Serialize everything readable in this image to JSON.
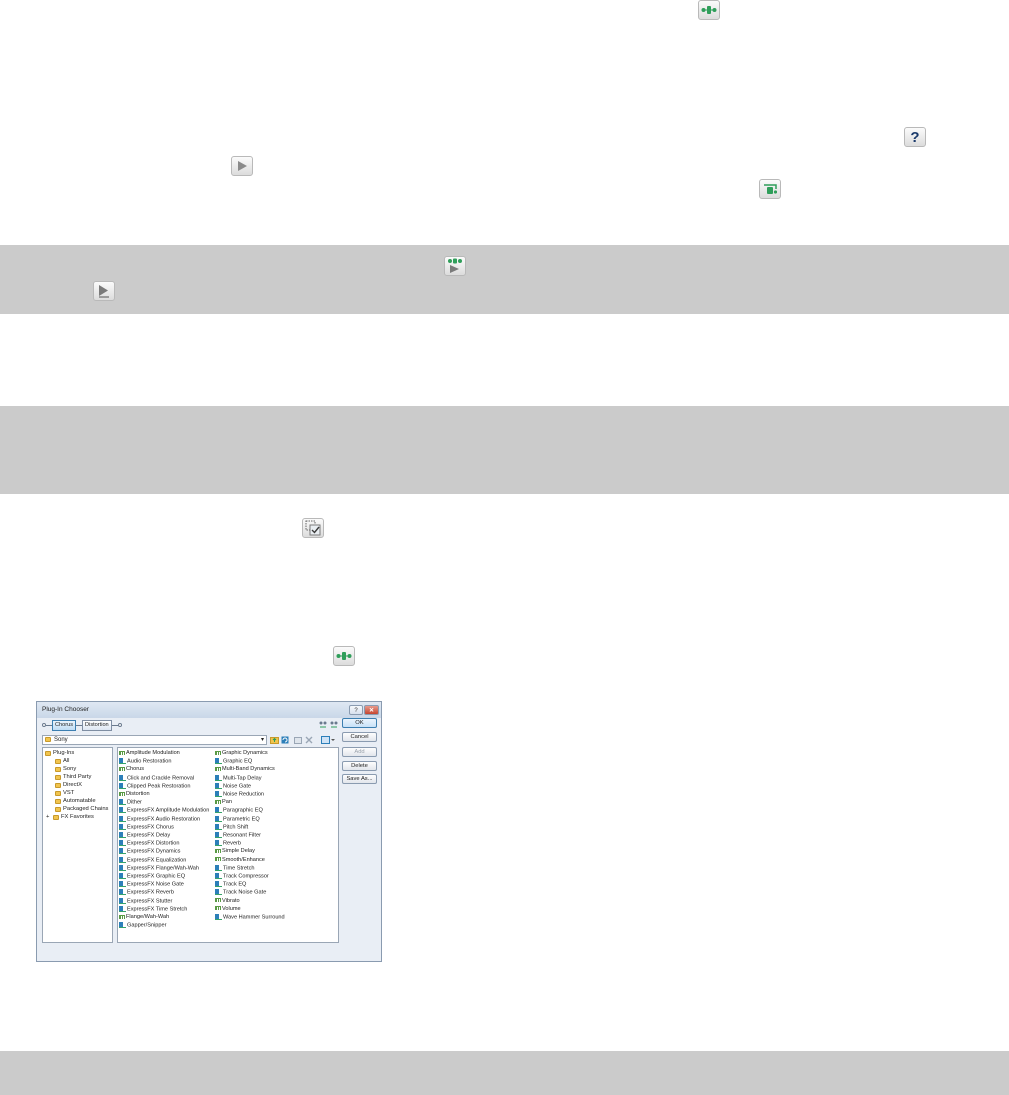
{
  "icons": {
    "plugin_chain": "plugin-chain-icon",
    "help": "help-icon",
    "play": "play-icon",
    "bypass": "bypass-icon",
    "chain_play": "chain-play-icon",
    "play_all": "play-all-icon",
    "select_all": "select-all-icon"
  },
  "colors": {
    "band": "#cbcbcb",
    "accent_green": "#2f9e5a",
    "help_blue": "#1a3a6b"
  },
  "dialog": {
    "title": "Plug-In Chooser",
    "help_glyph": "?",
    "close_glyph": "✕",
    "chain": [
      "Chorus",
      "Distortion"
    ],
    "buttons": {
      "ok": "OK",
      "cancel": "Cancel",
      "add": "Add",
      "delete": "Delete",
      "save_as": "Save As..."
    },
    "combo_value": "Sony",
    "tree": {
      "root": "Plug-Ins",
      "children": [
        "All",
        "Sony",
        "Third Party",
        "DirectX",
        "VST",
        "Automatable",
        "Packaged Chains"
      ],
      "favorites": "FX Favorites",
      "expander": "+"
    },
    "plugins_col1": [
      {
        "name": "Amplitude Modulation",
        "icon": "green"
      },
      {
        "name": "Audio Restoration",
        "icon": "blue"
      },
      {
        "name": "Chorus",
        "icon": "green"
      },
      {
        "name": "Click and Crackle Removal",
        "icon": "blue"
      },
      {
        "name": "Clipped Peak Restoration",
        "icon": "blue"
      },
      {
        "name": "Distortion",
        "icon": "green"
      },
      {
        "name": "Dither",
        "icon": "blue"
      },
      {
        "name": "ExpressFX Amplitude Modulation",
        "icon": "blue"
      },
      {
        "name": "ExpressFX Audio Restoration",
        "icon": "blue"
      },
      {
        "name": "ExpressFX Chorus",
        "icon": "blue"
      },
      {
        "name": "ExpressFX Delay",
        "icon": "blue"
      },
      {
        "name": "ExpressFX Distortion",
        "icon": "blue"
      },
      {
        "name": "ExpressFX Dynamics",
        "icon": "blue"
      },
      {
        "name": "ExpressFX Equalization",
        "icon": "blue"
      },
      {
        "name": "ExpressFX Flange/Wah-Wah",
        "icon": "blue"
      },
      {
        "name": "ExpressFX Graphic EQ",
        "icon": "blue"
      },
      {
        "name": "ExpressFX Noise Gate",
        "icon": "blue"
      },
      {
        "name": "ExpressFX Reverb",
        "icon": "blue"
      },
      {
        "name": "ExpressFX Stutter",
        "icon": "blue"
      },
      {
        "name": "ExpressFX Time Stretch",
        "icon": "blue"
      },
      {
        "name": "Flange/Wah-Wah",
        "icon": "green"
      },
      {
        "name": "Gapper/Snipper",
        "icon": "blue"
      }
    ],
    "plugins_col2": [
      {
        "name": "Graphic Dynamics",
        "icon": "green"
      },
      {
        "name": "Graphic EQ",
        "icon": "blue"
      },
      {
        "name": "Multi-Band Dynamics",
        "icon": "green"
      },
      {
        "name": "Multi-Tap Delay",
        "icon": "blue"
      },
      {
        "name": "Noise Gate",
        "icon": "blue"
      },
      {
        "name": "Noise Reduction",
        "icon": "blue"
      },
      {
        "name": "Pan",
        "icon": "green"
      },
      {
        "name": "Paragraphic EQ",
        "icon": "blue"
      },
      {
        "name": "Parametric EQ",
        "icon": "blue"
      },
      {
        "name": "Pitch Shift",
        "icon": "blue"
      },
      {
        "name": "Resonant Filter",
        "icon": "blue"
      },
      {
        "name": "Reverb",
        "icon": "blue"
      },
      {
        "name": "Simple Delay",
        "icon": "green"
      },
      {
        "name": "Smooth/Enhance",
        "icon": "green"
      },
      {
        "name": "Time Stretch",
        "icon": "blue"
      },
      {
        "name": "Track Compressor",
        "icon": "blue"
      },
      {
        "name": "Track EQ",
        "icon": "blue"
      },
      {
        "name": "Track Noise Gate",
        "icon": "blue"
      },
      {
        "name": "Vibrato",
        "icon": "green"
      },
      {
        "name": "Volume",
        "icon": "green"
      },
      {
        "name": "Wave Hammer Surround",
        "icon": "blue"
      }
    ]
  }
}
